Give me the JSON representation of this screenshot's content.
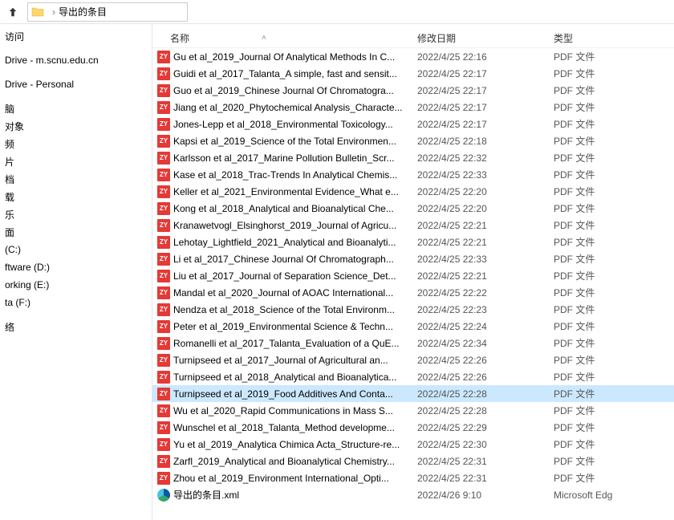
{
  "toolbar": {
    "folder_name": "导出的条目"
  },
  "columns": {
    "name": "名称",
    "date": "修改日期",
    "type": "类型"
  },
  "icon_text": {
    "pdf": "ZY"
  },
  "sidebar": {
    "items": [
      {
        "label": "访问"
      },
      {
        "spacer": true
      },
      {
        "label": "Drive - m.scnu.edu.cn"
      },
      {
        "spacer": true
      },
      {
        "label": "Drive - Personal"
      },
      {
        "spacer": true
      },
      {
        "label": "脑"
      },
      {
        "label": "对象"
      },
      {
        "label": "频"
      },
      {
        "label": "片"
      },
      {
        "label": "档"
      },
      {
        "label": "载"
      },
      {
        "label": "乐"
      },
      {
        "label": "面"
      },
      {
        "label": "(C:)"
      },
      {
        "label": "ftware (D:)"
      },
      {
        "label": "orking (E:)"
      },
      {
        "label": "ta (F:)"
      },
      {
        "spacer": true
      },
      {
        "label": "络"
      }
    ]
  },
  "files": [
    {
      "icon": "pdf",
      "name": "Gu et al_2019_Journal Of Analytical Methods In C...",
      "date": "2022/4/25 22:16",
      "type": "PDF 文件"
    },
    {
      "icon": "pdf",
      "name": "Guidi et al_2017_Talanta_A simple, fast and sensit...",
      "date": "2022/4/25 22:17",
      "type": "PDF 文件"
    },
    {
      "icon": "pdf",
      "name": "Guo et al_2019_Chinese Journal Of Chromatogra...",
      "date": "2022/4/25 22:17",
      "type": "PDF 文件"
    },
    {
      "icon": "pdf",
      "name": "Jiang et al_2020_Phytochemical Analysis_Characte...",
      "date": "2022/4/25 22:17",
      "type": "PDF 文件"
    },
    {
      "icon": "pdf",
      "name": "Jones-Lepp et al_2018_Environmental Toxicology...",
      "date": "2022/4/25 22:17",
      "type": "PDF 文件"
    },
    {
      "icon": "pdf",
      "name": "Kapsi et al_2019_Science of the Total Environmen...",
      "date": "2022/4/25 22:18",
      "type": "PDF 文件"
    },
    {
      "icon": "pdf",
      "name": "Karlsson et al_2017_Marine Pollution Bulletin_Scr...",
      "date": "2022/4/25 22:32",
      "type": "PDF 文件"
    },
    {
      "icon": "pdf",
      "name": "Kase et al_2018_Trac-Trends In Analytical Chemis...",
      "date": "2022/4/25 22:33",
      "type": "PDF 文件"
    },
    {
      "icon": "pdf",
      "name": "Keller et al_2021_Environmental Evidence_What e...",
      "date": "2022/4/25 22:20",
      "type": "PDF 文件"
    },
    {
      "icon": "pdf",
      "name": "Kong et al_2018_Analytical and Bioanalytical Che...",
      "date": "2022/4/25 22:20",
      "type": "PDF 文件"
    },
    {
      "icon": "pdf",
      "name": "Kranawetvogl_Elsinghorst_2019_Journal of Agricu...",
      "date": "2022/4/25 22:21",
      "type": "PDF 文件"
    },
    {
      "icon": "pdf",
      "name": "Lehotay_Lightfield_2021_Analytical and Bioanalyti...",
      "date": "2022/4/25 22:21",
      "type": "PDF 文件"
    },
    {
      "icon": "pdf",
      "name": "Li et al_2017_Chinese Journal Of Chromatograph...",
      "date": "2022/4/25 22:33",
      "type": "PDF 文件"
    },
    {
      "icon": "pdf",
      "name": "Liu et al_2017_Journal of Separation Science_Det...",
      "date": "2022/4/25 22:21",
      "type": "PDF 文件"
    },
    {
      "icon": "pdf",
      "name": "Mandal et al_2020_Journal of AOAC International...",
      "date": "2022/4/25 22:22",
      "type": "PDF 文件"
    },
    {
      "icon": "pdf",
      "name": "Nendza et al_2018_Science of the Total Environm...",
      "date": "2022/4/25 22:23",
      "type": "PDF 文件"
    },
    {
      "icon": "pdf",
      "name": "Peter et al_2019_Environmental Science & Techn...",
      "date": "2022/4/25 22:24",
      "type": "PDF 文件"
    },
    {
      "icon": "pdf",
      "name": "Romanelli et al_2017_Talanta_Evaluation of a QuE...",
      "date": "2022/4/25 22:34",
      "type": "PDF 文件"
    },
    {
      "icon": "pdf",
      "name": "Turnipseed et al_2017_Journal of Agricultural an...",
      "date": "2022/4/25 22:26",
      "type": "PDF 文件"
    },
    {
      "icon": "pdf",
      "name": "Turnipseed et al_2018_Analytical and Bioanalytica...",
      "date": "2022/4/25 22:26",
      "type": "PDF 文件"
    },
    {
      "icon": "pdf",
      "name": "Turnipseed et al_2019_Food Additives And Conta...",
      "date": "2022/4/25 22:28",
      "type": "PDF 文件",
      "selected": true
    },
    {
      "icon": "pdf",
      "name": "Wu et al_2020_Rapid Communications in Mass S...",
      "date": "2022/4/25 22:28",
      "type": "PDF 文件"
    },
    {
      "icon": "pdf",
      "name": "Wunschel et al_2018_Talanta_Method developme...",
      "date": "2022/4/25 22:29",
      "type": "PDF 文件"
    },
    {
      "icon": "pdf",
      "name": "Yu et al_2019_Analytica Chimica Acta_Structure-re...",
      "date": "2022/4/25 22:30",
      "type": "PDF 文件"
    },
    {
      "icon": "pdf",
      "name": "Zarfl_2019_Analytical and Bioanalytical Chemistry...",
      "date": "2022/4/25 22:31",
      "type": "PDF 文件"
    },
    {
      "icon": "pdf",
      "name": "Zhou et al_2019_Environment International_Opti...",
      "date": "2022/4/25 22:31",
      "type": "PDF 文件"
    },
    {
      "icon": "edge",
      "name": "导出的条目.xml",
      "date": "2022/4/26 9:10",
      "type": "Microsoft Edg"
    }
  ]
}
